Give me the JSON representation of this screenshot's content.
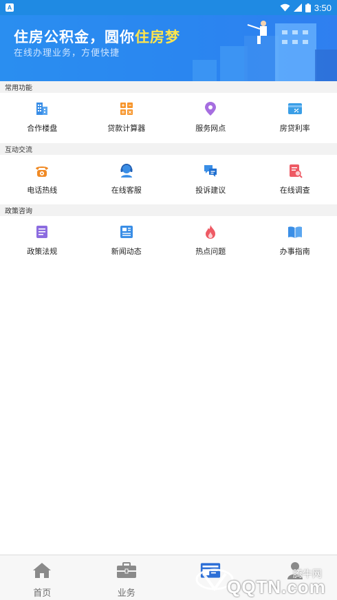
{
  "status_bar": {
    "app_badge": "A",
    "time": "3:50"
  },
  "banner": {
    "title_main": "住房公积金，圆你",
    "title_highlight": "住房梦",
    "subtitle": "在线办理业务，方便快捷",
    "highlight_color": "#ffe54c"
  },
  "sections": [
    {
      "title": "常用功能",
      "items": [
        {
          "label": "合作楼盘",
          "icon": "building-icon",
          "color": "#3a8ee6"
        },
        {
          "label": "贷款计算器",
          "icon": "calculator-icon",
          "color": "#f7952b"
        },
        {
          "label": "服务网点",
          "icon": "location-pin-icon",
          "color": "#a66ee0"
        },
        {
          "label": "房贷利率",
          "icon": "rate-card-icon",
          "color": "#3a9ee6"
        }
      ]
    },
    {
      "title": "互动交流",
      "items": [
        {
          "label": "电话热线",
          "icon": "phone-icon",
          "color": "#f08a25"
        },
        {
          "label": "在线客服",
          "icon": "customer-service-icon",
          "color": "#3a8ee6"
        },
        {
          "label": "投诉建议",
          "icon": "chat-bubble-icon",
          "color": "#3a8ee6"
        },
        {
          "label": "在线调查",
          "icon": "survey-icon",
          "color": "#ee5a64"
        }
      ]
    },
    {
      "title": "政策咨询",
      "items": [
        {
          "label": "政策法规",
          "icon": "policy-doc-icon",
          "color": "#8c6ce0"
        },
        {
          "label": "新闻动态",
          "icon": "newspaper-icon",
          "color": "#3a8ee6"
        },
        {
          "label": "热点问题",
          "icon": "flame-icon",
          "color": "#ee5a64"
        },
        {
          "label": "办事指南",
          "icon": "book-icon",
          "color": "#3a8ee6"
        }
      ]
    }
  ],
  "bottom_nav": [
    {
      "label": "首页",
      "icon": "home-icon"
    },
    {
      "label": "业务",
      "icon": "briefcase-icon"
    },
    {
      "label": "",
      "icon": "id-card-icon"
    },
    {
      "label": "",
      "icon": "person-icon"
    }
  ],
  "watermark": {
    "cn": "腾牛网",
    "en": "QQTN.com"
  }
}
